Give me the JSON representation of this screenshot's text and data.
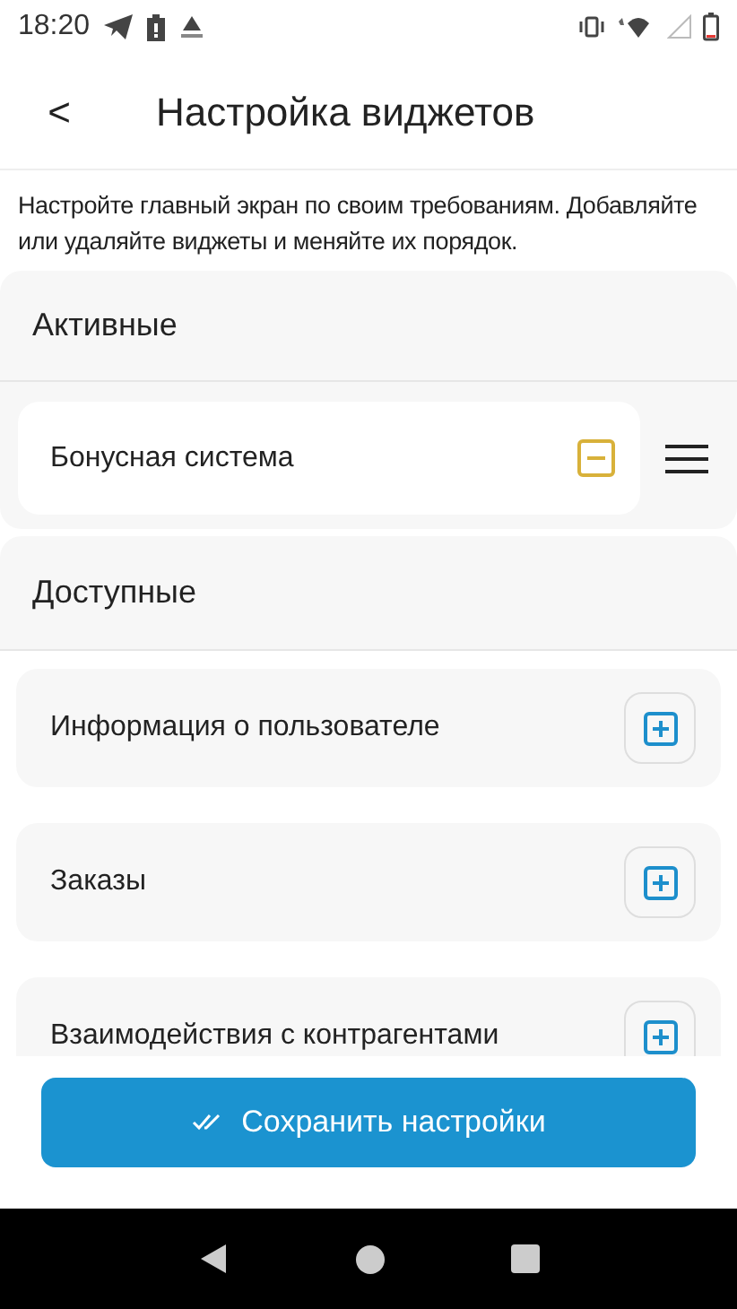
{
  "status_bar": {
    "time": "18:20"
  },
  "header": {
    "back": "<",
    "title": "Настройка виджетов"
  },
  "description": "Настройте главный экран по своим требованиям. Добавляйте или удаляйте виджеты и меняйте их порядок.",
  "sections": [
    {
      "title": "Активные",
      "items": [
        {
          "label": "Бонусная система",
          "kind": "active"
        }
      ]
    },
    {
      "title": "Доступные",
      "items": [
        {
          "label": "Информация о пользователе",
          "kind": "available"
        },
        {
          "label": "Заказы",
          "kind": "available"
        },
        {
          "label": "Взаимодействия с контрагентами",
          "kind": "available"
        }
      ]
    }
  ],
  "save_button": "Сохранить настройки"
}
